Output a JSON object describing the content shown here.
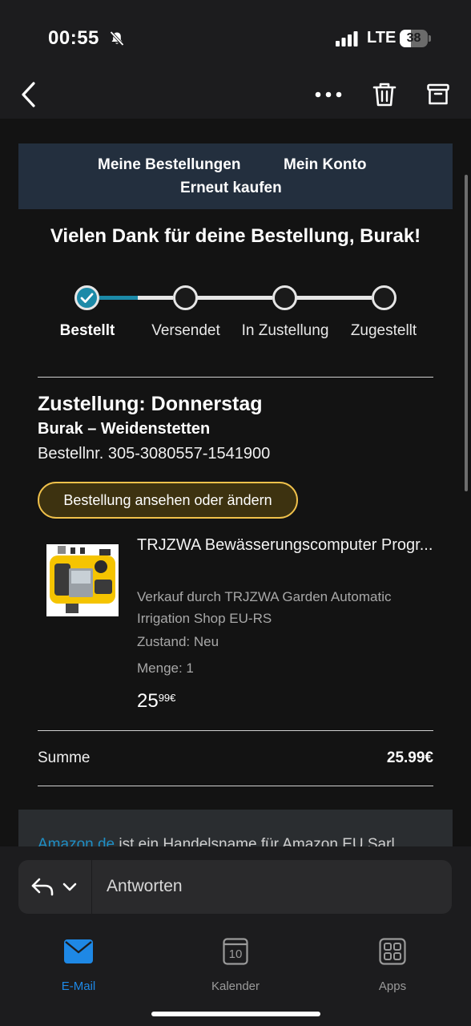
{
  "status_bar": {
    "time": "00:55",
    "network": "LTE",
    "battery": "38",
    "icons": [
      "bell-slash-icon",
      "signal-icon"
    ]
  },
  "nav": {
    "icons": [
      "back-chevron-icon",
      "more-icon",
      "trash-icon",
      "archive-icon"
    ]
  },
  "email": {
    "top_nav": {
      "my_orders": "Meine Bestellungen",
      "my_account": "Mein Konto",
      "buy_again": "Erneut kaufen"
    },
    "thanks": "Vielen Dank für deine Bestellung, Burak!",
    "tracker": {
      "steps": [
        "Bestellt",
        "Versendet",
        "In Zustellung",
        "Zugestellt"
      ],
      "current_step": 1,
      "accent": "#1c8aa8"
    },
    "delivery": {
      "title": "Zustellung: Donnerstag",
      "name": "Burak – Weidenstetten",
      "order_number": "Bestellnr. 305-3080557-1541900"
    },
    "view_order_button": "Bestellung ansehen oder ändern",
    "product": {
      "title": "TRJZWA Bewässerungscomputer Progr...",
      "seller": "Verkauf durch TRJZWA Garden Automatic Irrigation Shop EU-RS",
      "condition": "Zustand: Neu",
      "quantity": "Menge: 1",
      "price_whole": "25",
      "price_fraction": "99€"
    },
    "summary": {
      "label": "Summe",
      "value": "25.99€"
    },
    "footer": {
      "link": "Amazon.de",
      "text": " ist ein Handelsname für Amazon EU Sarl"
    }
  },
  "reply": {
    "label": "Antworten"
  },
  "tabs": [
    {
      "label": "E-Mail",
      "icon": "mail-icon",
      "active": true
    },
    {
      "label": "Kalender",
      "icon": "calendar-icon",
      "badge": "10",
      "active": false
    },
    {
      "label": "Apps",
      "icon": "apps-icon",
      "active": false
    }
  ],
  "colors": {
    "brand_header": "#232f3e",
    "button_border": "#f0c14b",
    "active_tab": "#1e88e5",
    "link": "#1f8ec4"
  }
}
